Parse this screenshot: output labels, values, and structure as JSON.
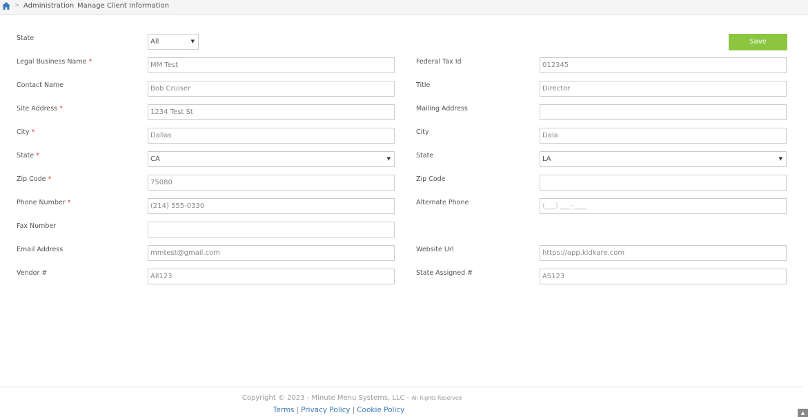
{
  "breadcrumb": {
    "items": [
      "Administration",
      "Manage Client Information"
    ],
    "separator": ">"
  },
  "form": {
    "top_state": {
      "label": "State",
      "value": "All"
    },
    "save_label": "Save",
    "legal_business_name": {
      "label": "Legal Business Name",
      "required": "*",
      "value": "MM Test"
    },
    "federal_tax_id": {
      "label": "Federal Tax Id",
      "value": "012345"
    },
    "contact_name": {
      "label": "Contact Name",
      "value": "Bob Cruiser"
    },
    "title": {
      "label": "Title",
      "value": "Director"
    },
    "site_address": {
      "label": "Site Address",
      "required": "*",
      "value": "1234 Test St"
    },
    "mailing_address": {
      "label": "Mailing Address",
      "value": ""
    },
    "city": {
      "label": "City",
      "required": "*",
      "value": "Dallas"
    },
    "mailing_city": {
      "label": "City",
      "value": "Dala"
    },
    "state": {
      "label": "State",
      "required": "*",
      "value": "CA"
    },
    "mailing_state": {
      "label": "State",
      "value": "LA"
    },
    "zip_code": {
      "label": "Zip Code",
      "required": "*",
      "value": "75080"
    },
    "mailing_zip_code": {
      "label": "Zip Code",
      "value": ""
    },
    "phone_number": {
      "label": "Phone Number",
      "required": "*",
      "value": "(214) 555-0330"
    },
    "alternate_phone": {
      "label": "Alternate Phone",
      "placeholder": "(___) ___-____"
    },
    "fax_number": {
      "label": "Fax Number",
      "value": ""
    },
    "email_address": {
      "label": "Email Address",
      "value": "mmtest@gmail.com"
    },
    "website_url": {
      "label": "Website Url",
      "value": "https://app.kidkare.com"
    },
    "vendor_number": {
      "label": "Vendor #",
      "value": "All123"
    },
    "state_assigned_number": {
      "label": "State Assigned #",
      "value": "AS123"
    }
  },
  "footer": {
    "copyright": "Copyright © 2023 - Minute Menu Systems, LLC -",
    "rights": "All Rights Reserved",
    "links": [
      "Terms",
      "Privacy Policy",
      "Cookie Policy"
    ],
    "separator": "|"
  },
  "colors": {
    "save_button": "#8cc540",
    "link": "#3a79b8",
    "home_icon": "#3a79b8",
    "required": "#d33333"
  },
  "icons": {
    "home": "home-icon",
    "dropdown": "caret-down-icon",
    "scroll_top": "chevron-up-icon"
  }
}
